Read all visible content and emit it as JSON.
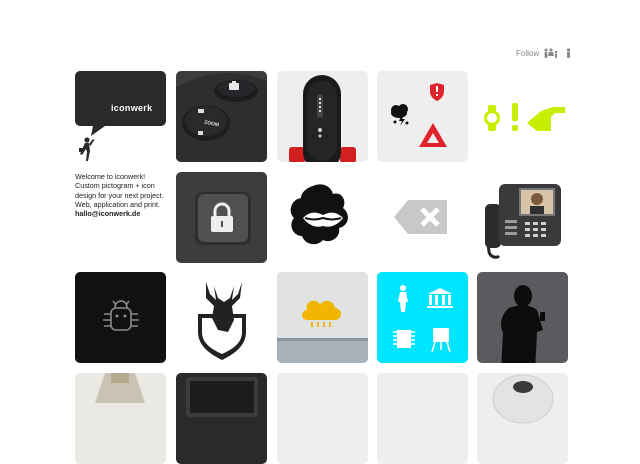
{
  "header": {
    "follow_label": "Follow",
    "icons": [
      "family-icon",
      "person-icon"
    ]
  },
  "brand": {
    "logo_text": "iconwerk",
    "icons": [
      "speech-bubble-icon",
      "person-waving-icon"
    ]
  },
  "about": {
    "lines": [
      "Welcome to iconwerk!",
      "Custom pictogram + icon",
      "design for your next project.",
      "Web, application and print."
    ],
    "email": "hallo@iconwerk.de"
  },
  "tiles": [
    {
      "name": "tile-remote-buttons",
      "bg": "#3c3c3e",
      "zoom_label": "ZOOM"
    },
    {
      "name": "tile-black-remote",
      "bg": "#eeeeef"
    },
    {
      "name": "tile-weather-warning-icons",
      "bg": "#eeeeef"
    },
    {
      "name": "tile-hand-watch-icons",
      "bg": "#ffffff",
      "accent": "#c6ef00"
    },
    {
      "name": "tile-lock-button",
      "bg": "#3c3c3e"
    },
    {
      "name": "tile-lips-logo",
      "bg": "#ffffff"
    },
    {
      "name": "tile-delete-key",
      "bg": "#ffffff"
    },
    {
      "name": "tile-video-phone",
      "bg": "#ffffff"
    },
    {
      "name": "tile-bug-icon",
      "bg": "#111111"
    },
    {
      "name": "tile-deer-crest",
      "bg": "#ffffff"
    },
    {
      "name": "tile-rain-cloud",
      "bg": "#d9dadc",
      "accent": "#f2b500"
    },
    {
      "name": "tile-cyan-pictograms",
      "bg": "#00e5ff"
    },
    {
      "name": "tile-phone-user",
      "bg": "#5a5b5e"
    },
    {
      "name": "tile-portrait-partial",
      "bg": "#ebe9e4"
    },
    {
      "name": "tile-dark-device-partial",
      "bg": "#2a2a2b"
    },
    {
      "name": "tile-blank-1",
      "bg": "#eeeeef"
    },
    {
      "name": "tile-blank-2",
      "bg": "#eeeeef"
    },
    {
      "name": "tile-camera-partial",
      "bg": "#eeeeef"
    }
  ]
}
